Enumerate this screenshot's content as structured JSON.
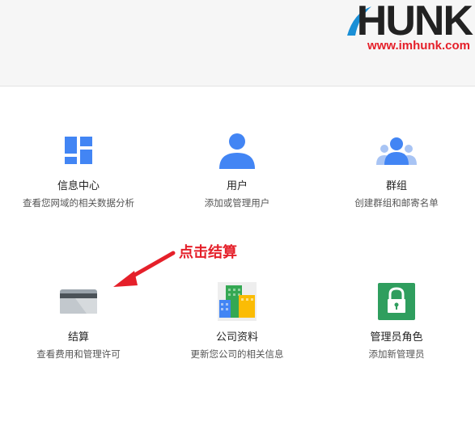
{
  "header": {
    "logo_text": "HUNK",
    "logo_url": "www.imhunk.com"
  },
  "cards": [
    {
      "title": "信息中心",
      "desc": "查看您网域的相关数据分析",
      "icon": "dashboard-icon"
    },
    {
      "title": "用户",
      "desc": "添加或管理用户",
      "icon": "user-icon"
    },
    {
      "title": "群组",
      "desc": "创建群组和邮寄名单",
      "icon": "group-icon"
    },
    {
      "title": "结算",
      "desc": "查看费用和管理许可",
      "icon": "billing-card-icon"
    },
    {
      "title": "公司资料",
      "desc": "更新您公司的相关信息",
      "icon": "company-building-icon"
    },
    {
      "title": "管理员角色",
      "desc": "添加新管理员",
      "icon": "admin-lock-icon"
    }
  ],
  "annotation": {
    "text": "点击结算"
  },
  "colors": {
    "accent_blue": "#4285f4",
    "annotation_red": "#e5202a",
    "admin_green": "#2f9e5e"
  }
}
